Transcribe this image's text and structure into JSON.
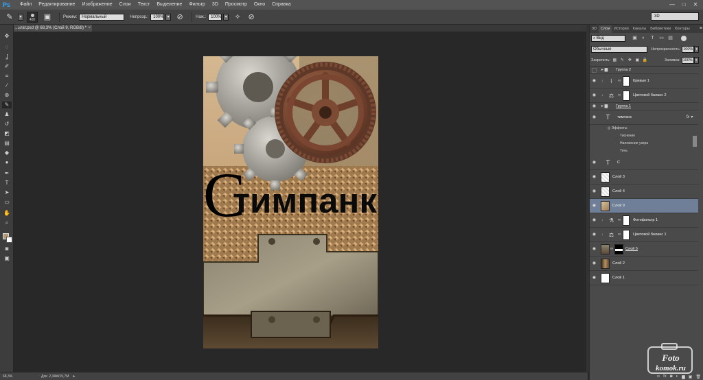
{
  "app": {
    "logo": "Ps",
    "menu": [
      "Файл",
      "Редактирование",
      "Изображение",
      "Слои",
      "Текст",
      "Выделение",
      "Фильтр",
      "3D",
      "Просмотр",
      "Окно",
      "Справка"
    ],
    "window_controls": [
      "—",
      "□",
      "✕"
    ]
  },
  "options": {
    "brush_size": "400",
    "mode_label": "Режим:",
    "mode_value": "Нормальный",
    "opacity_label": "Непрозр.:",
    "opacity_value": "100%",
    "flow_label": "Наж.:",
    "flow_value": "100%",
    "workspace": "3D"
  },
  "document": {
    "tab_title": "...ьтат.psd @ 68,3% (Слой 9, RGB/8) *",
    "artwork_title": "тимпанк",
    "artwork_initial": "С"
  },
  "status": {
    "zoom": "68,3%",
    "doc_size": "Док: 2,34М/15,7М"
  },
  "panel": {
    "tabs": [
      "3D",
      "Слои",
      "История",
      "Каналы",
      "Библиотеки",
      "Контуры"
    ],
    "active_tab": "Слои",
    "filter_kind": "Вид",
    "blend_mode": "Обычные",
    "opacity_label": "Непрозрачность:",
    "opacity_value": "100%",
    "lock_label": "Закрепить:",
    "fill_label": "Заливка:",
    "fill_value": "100%"
  },
  "layers": [
    {
      "name": "Группа 2",
      "type": "group",
      "visible": false
    },
    {
      "name": "Кривые 1",
      "type": "curves",
      "visible": true
    },
    {
      "name": "Цветовой баланс 2",
      "type": "balance",
      "visible": true
    },
    {
      "name": "Группа 1",
      "type": "group",
      "visible": true
    },
    {
      "name": "тимпанк",
      "type": "text",
      "visible": true
    },
    {
      "name": "С",
      "type": "text",
      "visible": true
    },
    {
      "name": "Слой 3",
      "type": "pixel",
      "visible": true
    },
    {
      "name": "Слой 4",
      "type": "pixel",
      "visible": true
    },
    {
      "name": "Слой 9",
      "type": "pixel",
      "visible": true,
      "selected": true
    },
    {
      "name": "Фотофильтр 1",
      "type": "photofilter",
      "visible": true
    },
    {
      "name": "Цветовой баланс 1",
      "type": "balance",
      "visible": true
    },
    {
      "name": "Слой 5",
      "type": "pixel-mask",
      "visible": true
    },
    {
      "name": "Слой 2",
      "type": "pixel",
      "visible": true
    },
    {
      "name": "Слой 1",
      "type": "pixel",
      "visible": true
    }
  ],
  "effects": {
    "header": "Эффекты",
    "items": [
      "Тиснение",
      "Наложение узора",
      "Тень"
    ]
  },
  "watermark": {
    "line1": "Foto",
    "line2": "komok.ru"
  },
  "colors": {
    "foreground": "#b39a76",
    "background": "#ffffff",
    "selected_layer": "#6f7f97"
  }
}
